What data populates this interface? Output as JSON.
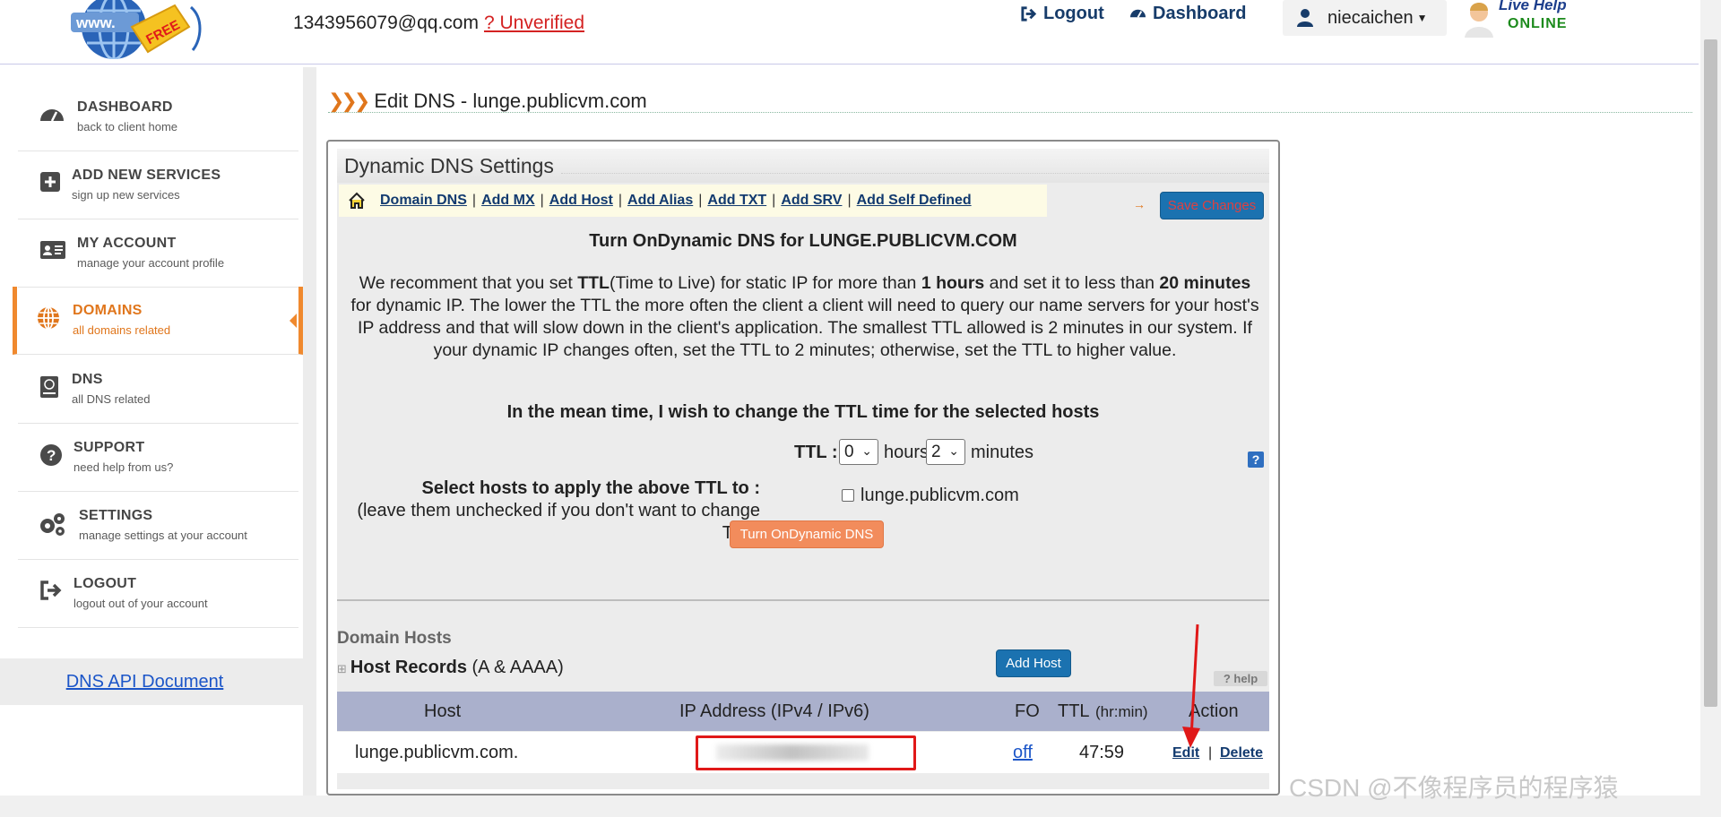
{
  "header": {
    "logo_text": "FREE",
    "email": "1343956079@qq.com",
    "unverified": "? Unverified",
    "logout": "Logout",
    "dashboard": "Dashboard",
    "username": "niecaichen",
    "live_help_line1": "Live Help",
    "live_help_line2": "ONLINE"
  },
  "sidebar": {
    "items": [
      {
        "title": "DASHBOARD",
        "sub": "back to client home",
        "icon": "dashboard-icon"
      },
      {
        "title": "ADD NEW SERVICES",
        "sub": "sign up new services",
        "icon": "plus-square-icon"
      },
      {
        "title": "MY ACCOUNT",
        "sub": "manage your account profile",
        "icon": "id-card-icon"
      },
      {
        "title": "DOMAINS",
        "sub": "all domains related",
        "icon": "globe-icon"
      },
      {
        "title": "DNS",
        "sub": "all DNS related",
        "icon": "book-icon"
      },
      {
        "title": "SUPPORT",
        "sub": "need help from us?",
        "icon": "question-circle-icon"
      },
      {
        "title": "SETTINGS",
        "sub": "manage settings at your account",
        "icon": "gears-icon"
      },
      {
        "title": "LOGOUT",
        "sub": "logout out of your account",
        "icon": "sign-out-icon"
      }
    ],
    "api_link": "DNS API Document"
  },
  "main": {
    "page_title": "Edit DNS - lunge.publicvm.com",
    "panel_title": "Dynamic DNS Settings",
    "toolbar": [
      "Domain DNS",
      "Add MX",
      "Add Host",
      "Add Alias",
      "Add TXT",
      "Add SRV",
      "Add Self Defined"
    ],
    "save_changes": "Save Changes",
    "turn_title": "Turn OnDynamic DNS for LUNGE.PUBLICVM.COM",
    "para": {
      "p1": "We recomment that you set ",
      "ttl": "TTL",
      "p2": "(Time to Live) for static IP for more than ",
      "hours": "1 hours",
      "p3": " and set it to less than ",
      "minutes": "20 minutes",
      "p4": " for dynamic IP. The lower the TTL the more often the client a client will need to query our name servers for your host's IP address and that will slow down in the client's application. The smallest TTL allowed is 2 minutes in our system. If your dynamic IP changes often, set the TTL to 2 minutes; otherwise, set the TTL to higher value."
    },
    "mean_time": "In the mean time, I wish to change the TTL time for the selected hosts",
    "ttl_label": "TTL :",
    "ttl_hours_value": "0",
    "hours_unit": "hours",
    "ttl_minutes_value": "2",
    "minutes_unit": "minutes",
    "select_hosts_label": "Select hosts to apply the above TTL to :",
    "select_hosts_note": "(leave them unchecked if you don't want to change TTL)",
    "host_checkbox_label": "lunge.publicvm.com",
    "turn_on_button": "Turn OnDynamic DNS",
    "domain_hosts_title": "Domain Hosts",
    "host_records_title": "Host Records",
    "host_records_suffix": " (A & AAAA)",
    "add_host_button": "Add Host",
    "help_button": "help",
    "table": {
      "headers": {
        "host": "Host",
        "ip": "IP Address (IPv4 / IPv6)",
        "fo": "FO",
        "ttl": "TTL",
        "ttl_unit": "(hr:min)",
        "action": "Action"
      },
      "row": {
        "host": "lunge.publicvm.com.",
        "fo": "off",
        "ttl": "47:59",
        "edit": "Edit",
        "delete": "Delete"
      }
    }
  },
  "watermark": "CSDN @不像程序员的程序猿"
}
